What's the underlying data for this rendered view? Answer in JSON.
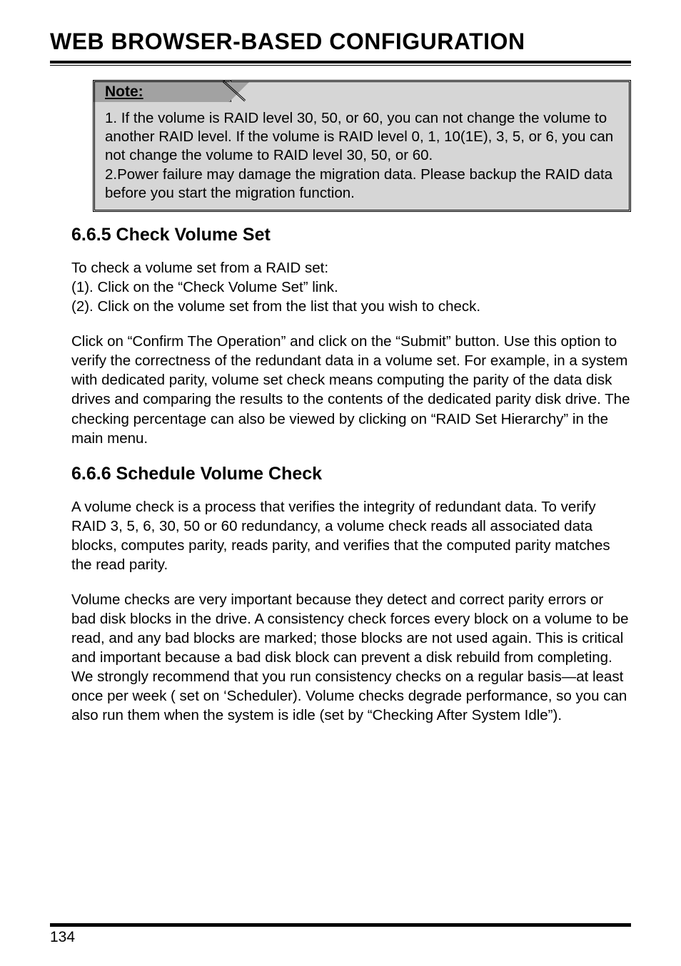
{
  "page": {
    "title": "WEB BROWSER-BASED CONFIGURATION",
    "number": "134"
  },
  "note": {
    "label": "Note:",
    "body": "1. If the volume is RAID level 30, 50, or 60, you can not change the volume to another RAID level. If the volume is RAID level 0, 1, 10(1E), 3, 5, or 6, you can not change the volume to RAID level 30, 50, or 60.\n2.Power failure may damage the migration data. Please backup the RAID data before you start the migration function."
  },
  "sections": [
    {
      "heading": "6.6.5 Check Volume Set",
      "paragraphs": [
        "To check a volume set from a RAID set:\n(1). Click on the “Check Volume Set” link.\n(2). Click on the volume set from the list that you wish to check.",
        "Click on “Confirm The Operation” and click on the “Submit” button. Use this option to verify the correctness of the redundant data in a volume set. For example, in a system with dedicated parity, volume set check means computing the parity of the data disk drives and comparing the results to the contents of the dedicated parity disk drive. The checking percentage can also be viewed by clicking on “RAID Set Hierarchy” in the main menu."
      ]
    },
    {
      "heading": "6.6.6 Schedule Volume Check",
      "paragraphs": [
        "A volume check is a process that verifies the integrity of redundant data. To verify RAID 3, 5, 6, 30, 50 or 60 redundancy, a volume check reads all associated data blocks, computes parity, reads parity, and verifies that the computed parity matches the read parity.",
        "Volume checks are very important because they detect and correct parity errors or bad disk blocks in the drive. A consistency check forces every block on a volume to be read, and any bad blocks are marked; those blocks are not used again. This is critical and important because a bad disk block can prevent a disk rebuild from completing. We strongly recommend that you run consistency checks on a regular basis—at least once per week ( set on ‘Scheduler). Volume checks degrade performance, so you can also run them when the system is idle (set by “Checking After System Idle”)."
      ]
    }
  ]
}
